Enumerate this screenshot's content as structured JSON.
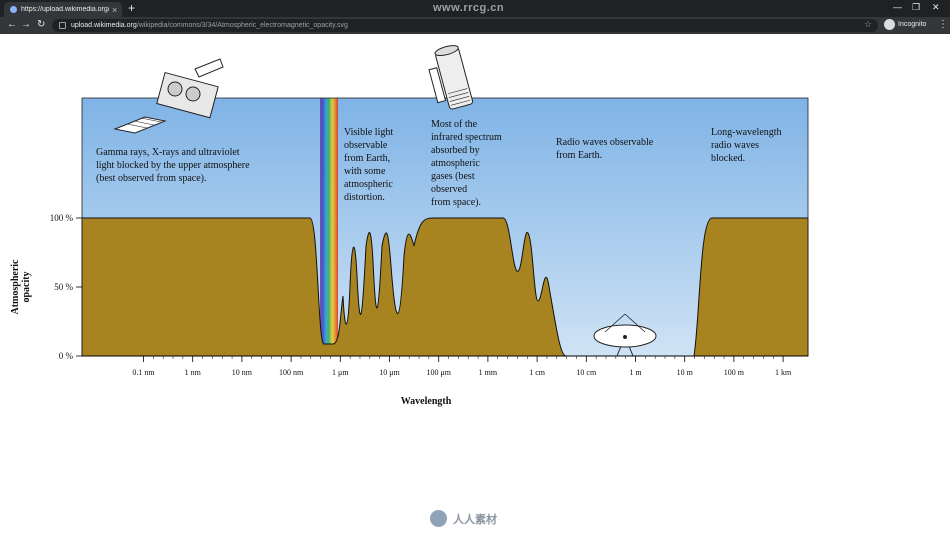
{
  "browser": {
    "tab_title": "https://upload.wikimedia.org/wik",
    "tab_close": "×",
    "new_tab": "+",
    "watermark_site": "www.rrcg.cn",
    "url_host": "upload.wikimedia.org",
    "url_path": "/wikipedia/commons/3/34/Atmospheric_electromagnetic_opacity.svg",
    "profile_label": "Incognito",
    "back": "←",
    "forward": "→",
    "reload": "↻",
    "star": "☆",
    "menu": "⋮",
    "minimize": "—",
    "maximize": "❐",
    "close": "✕"
  },
  "chart_data": {
    "type": "area",
    "xlabel": "Wavelength",
    "ylabel": "Atmospheric opacity",
    "y_ticks": [
      "100 %",
      "50 %",
      "0 %"
    ],
    "x_ticks": [
      "0.1 nm",
      "1 nm",
      "10 nm",
      "100 nm",
      "1 μm",
      "10 μm",
      "100 μm",
      "1 mm",
      "1 cm",
      "10 cm",
      "1 m",
      "10 m",
      "100 m",
      "1 km"
    ],
    "ylim": [
      0,
      100
    ],
    "colors": {
      "sky_top": "#7fb3e6",
      "sky_bottom": "#cfe3f5",
      "ground": "#a88420",
      "spectrum": [
        "#7a3aa8",
        "#3050c8",
        "#30a0d8",
        "#38b050",
        "#e0d030",
        "#f09020",
        "#e03020"
      ]
    },
    "annotations": [
      "Gamma rays, X-rays and ultraviolet light blocked by the upper atmosphere (best observed from space).",
      "Visible light observable from Earth, with some atmospheric distortion.",
      "Most of the infrared spectrum absorbed by atmospheric gases (best observed from space).",
      "Radio waves observable from Earth.",
      "Long-wavelength radio waves blocked."
    ],
    "annotation_lines": [
      [
        "Gamma rays, X-rays and ultraviolet",
        "light blocked by the upper atmosphere",
        "(best observed from space)."
      ],
      [
        "Visible light",
        "observable",
        "from Earth,",
        "with some",
        "atmospheric",
        "distortion."
      ],
      [
        "Most of the",
        "infrared spectrum",
        "absorbed by",
        "atmospheric",
        "gases (best",
        "observed",
        "from space)."
      ],
      [
        "Radio waves observable",
        "from Earth."
      ],
      [
        "Long-wavelength",
        "radio waves",
        "blocked."
      ]
    ],
    "opacity_profile": [
      {
        "wavelength": "0.1 nm",
        "opacity": 100
      },
      {
        "wavelength": "100 nm",
        "opacity": 100
      },
      {
        "wavelength": "300 nm",
        "opacity": 100
      },
      {
        "wavelength": "400 nm",
        "opacity": 10
      },
      {
        "wavelength": "700 nm",
        "opacity": 10
      },
      {
        "wavelength": "1 μm",
        "opacity": 50
      },
      {
        "wavelength": "2 μm",
        "opacity": 85
      },
      {
        "wavelength": "3 μm",
        "opacity": 85
      },
      {
        "wavelength": "10 μm",
        "opacity": 20
      },
      {
        "wavelength": "15 μm",
        "opacity": 90
      },
      {
        "wavelength": "30 μm",
        "opacity": 100
      },
      {
        "wavelength": "1 mm",
        "opacity": 100
      },
      {
        "wavelength": "3 mm",
        "opacity": 65
      },
      {
        "wavelength": "6 mm",
        "opacity": 60
      },
      {
        "wavelength": "1 cm",
        "opacity": 55
      },
      {
        "wavelength": "2 cm",
        "opacity": 0
      },
      {
        "wavelength": "10 m",
        "opacity": 0
      },
      {
        "wavelength": "20 m",
        "opacity": 100
      },
      {
        "wavelength": "1 km",
        "opacity": 100
      }
    ]
  },
  "watermark_bottom": "人人素材"
}
